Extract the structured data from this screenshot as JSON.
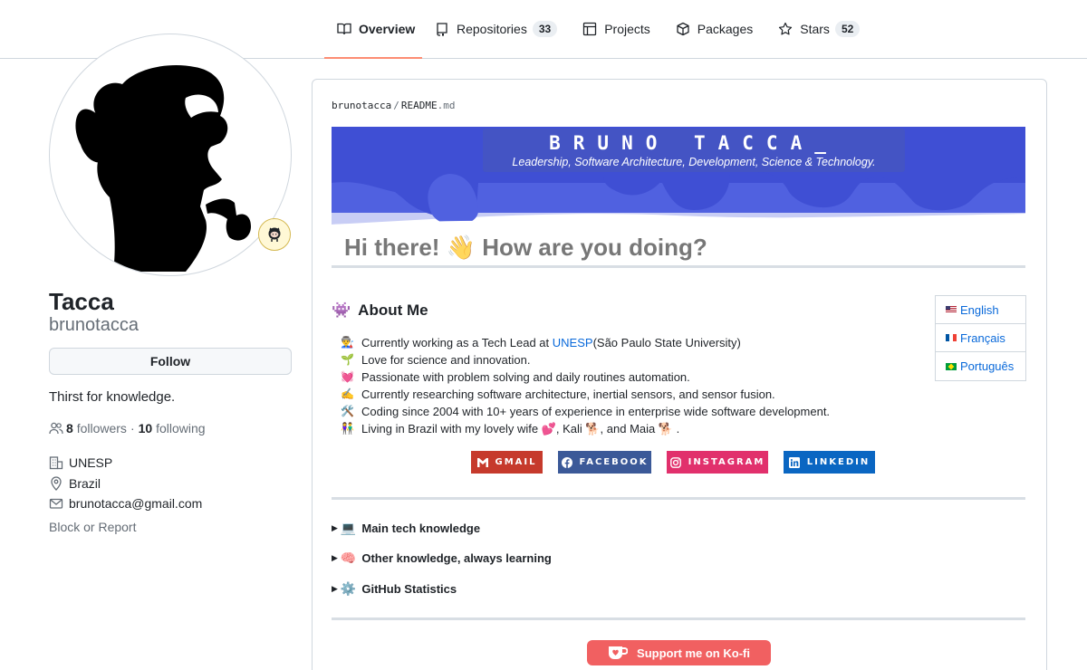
{
  "nav": {
    "tabs": [
      {
        "label": "Overview",
        "icon": "book-icon",
        "active": true
      },
      {
        "label": "Repositories",
        "icon": "repo-icon",
        "count": "33"
      },
      {
        "label": "Projects",
        "icon": "table-icon"
      },
      {
        "label": "Packages",
        "icon": "package-icon"
      },
      {
        "label": "Stars",
        "icon": "star-icon",
        "count": "52"
      }
    ]
  },
  "profile": {
    "fullname": "Tacca",
    "username": "brunotacca",
    "follow_label": "Follow",
    "bio": "Thirst for knowledge.",
    "followers_count": "8",
    "followers_label": "followers",
    "sep": "·",
    "following_count": "10",
    "following_label": "following",
    "org": "UNESP",
    "location": "Brazil",
    "email": "brunotacca@gmail.com",
    "block_label": "Block or Report",
    "status_icon": "octocat-icon"
  },
  "readme": {
    "path_user": "brunotacca",
    "path_sep": "/",
    "path_file": "README",
    "path_ext": ".md",
    "banner_title": "BRUNO TACCA_",
    "banner_subtitle": "Leadership, Software Architecture, Development, Science & Technology.",
    "greeting": "Hi there! 👋 How are you doing?",
    "about_emoji": "👾",
    "about_title": "About Me",
    "languages": [
      {
        "label": "English",
        "flag": "us"
      },
      {
        "label": "Français",
        "flag": "fr"
      },
      {
        "label": "Português",
        "flag": "br"
      }
    ],
    "about": [
      {
        "emoji": "👨‍🏭",
        "pre": "Currently working as a Tech Lead at ",
        "link": "UNESP",
        "post": " (São Paulo State University)"
      },
      {
        "emoji": "🌱",
        "pre": "Love for science and innovation.",
        "link": "",
        "post": ""
      },
      {
        "emoji": "💓",
        "pre": "Passionate with problem solving and daily routines automation.",
        "link": "",
        "post": ""
      },
      {
        "emoji": "✍️",
        "pre": "Currently researching software architecture, inertial sensors, and sensor fusion.",
        "link": "",
        "post": ""
      },
      {
        "emoji": "🛠️",
        "pre": "Coding since 2004 with 10+ years of experience in enterprise wide software development.",
        "link": "",
        "post": ""
      },
      {
        "emoji": "👫",
        "pre": "Living in Brazil with my lovely wife 💕, Kali 🐕, and Maia 🐕 .",
        "link": "",
        "post": ""
      }
    ],
    "badges": [
      {
        "label": "GMAIL",
        "color": "#c63a2c"
      },
      {
        "label": "FACEBOOK",
        "color": "#3b5998"
      },
      {
        "label": "INSTAGRAM",
        "color": "#e1306c"
      },
      {
        "label": "LINKEDIN",
        "color": "#0a66c2"
      }
    ],
    "details": [
      {
        "emoji": "💻",
        "label": "Main tech knowledge"
      },
      {
        "emoji": "🧠",
        "label": "Other knowledge, always learning"
      },
      {
        "emoji": "⚙️",
        "label": "GitHub Statistics"
      }
    ],
    "kofi_label": "Support me on Ko-fi"
  },
  "colors": {
    "tab_active_border": "#fd8c73",
    "link": "#0969da",
    "banner_blue": "#4454c4",
    "kofi": "#f16061"
  }
}
